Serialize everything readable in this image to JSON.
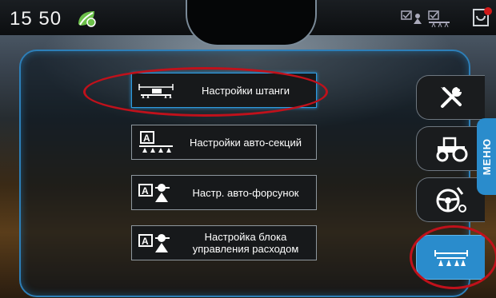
{
  "status_bar": {
    "time": "15 50",
    "icons": [
      "leaf-icon",
      "sprayer-status-icon",
      "boom-status-icon",
      "alert-icon"
    ]
  },
  "menu": {
    "items": [
      {
        "label": "Настройки штанги",
        "icon": "boom-icon",
        "active": true
      },
      {
        "label": "Настройки авто-секций",
        "icon": "auto-section-icon",
        "active": false
      },
      {
        "label": "Настр. авто-форсунок",
        "icon": "auto-nozzle-icon",
        "active": false
      },
      {
        "label": "Настройка блока управления расходом",
        "icon": "rate-control-icon",
        "active": false
      }
    ]
  },
  "side_tabs": [
    {
      "name": "tools-tab",
      "icon": "wrench-screwdriver-icon",
      "active": false
    },
    {
      "name": "tractor-tab",
      "icon": "tractor-icon",
      "active": false
    },
    {
      "name": "steering-tab",
      "icon": "steering-wheel-icon",
      "active": false
    },
    {
      "name": "sprayer-tab",
      "icon": "sprayer-boom-icon",
      "active": true
    }
  ],
  "side_menu_label": "МЕНЮ",
  "colors": {
    "accent": "#2a8ccc",
    "highlight": "#c0111b"
  }
}
